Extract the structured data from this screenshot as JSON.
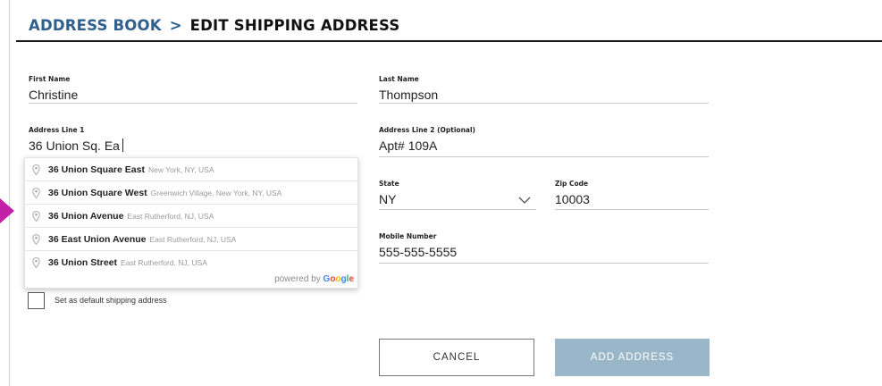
{
  "header": {
    "breadcrumb_parent": "ADDRESS BOOK",
    "separator": ">",
    "title": "EDIT SHIPPING ADDRESS"
  },
  "form": {
    "first_name": {
      "label": "First Name",
      "value": "Christine"
    },
    "last_name": {
      "label": "Last Name",
      "value": "Thompson"
    },
    "address_line_1": {
      "label": "Address Line 1",
      "value": "36 Union Sq. Ea"
    },
    "address_line_2": {
      "label": "Address Line 2 (Optional)",
      "value": "Apt# 109A"
    },
    "state": {
      "label": "State",
      "value": "NY"
    },
    "zip_code": {
      "label": "Zip Code",
      "value": "10003"
    },
    "mobile_number": {
      "label": "Mobile Number",
      "value": "555-555-5555"
    }
  },
  "autocomplete": {
    "suggestions": [
      {
        "main": "36 Union Square East",
        "secondary": "New York, NY, USA"
      },
      {
        "main": "36 Union Square West",
        "secondary": "Greenwich Village, New York, NY, USA"
      },
      {
        "main": "36 Union Avenue",
        "secondary": "East Rutherford, NJ, USA"
      },
      {
        "main": "36 East Union Avenue",
        "secondary": "East Rutherford, NJ, USA"
      },
      {
        "main": "36 Union Street",
        "secondary": "East Rutherford, NJ, USA"
      }
    ],
    "powered_by": "powered by",
    "brand_letters": [
      "G",
      "o",
      "o",
      "g",
      "l",
      "e"
    ],
    "pin_icon": "map-pin-icon"
  },
  "default_checkbox": {
    "label": "Set as default shipping address",
    "checked": false
  },
  "buttons": {
    "cancel": "CANCEL",
    "add": "ADD ADDRESS"
  },
  "colors": {
    "breadcrumb": "#2f5f8d",
    "add_button": "#9ab7ca",
    "pointer": "#c21fa8"
  }
}
